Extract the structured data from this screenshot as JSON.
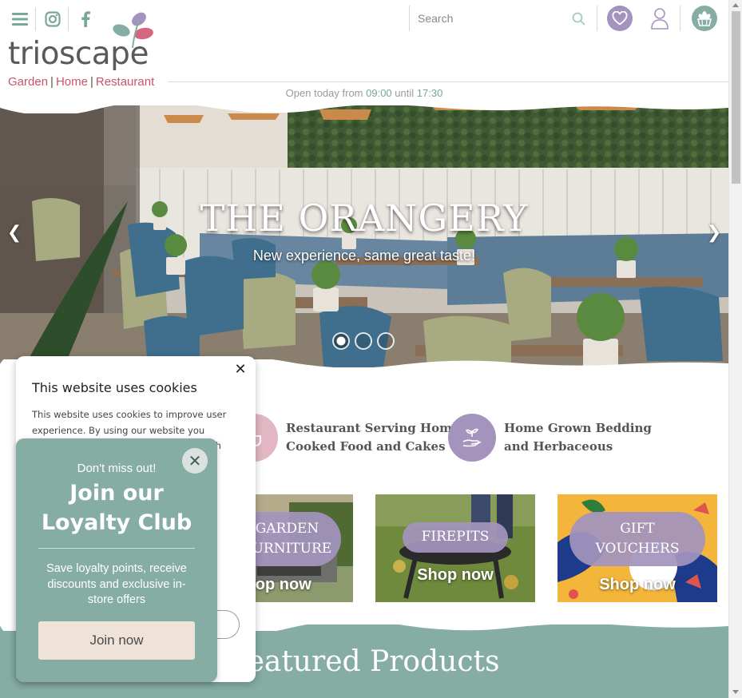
{
  "header": {
    "search_placeholder": "Search",
    "opening_prefix": "Open today from",
    "open_time": "09:00",
    "opening_mid": "until",
    "close_time": "17:30"
  },
  "logo": {
    "name": "trioscape",
    "sub1": "Garden",
    "sub2": "Home",
    "sub3": "Restaurant"
  },
  "hero": {
    "title": "THE ORANGERY",
    "subtitle": "New experience, same great taste!",
    "slides": 3,
    "active_slide": 1
  },
  "features": [
    {
      "line1": "Restaurant Serving Home-",
      "line2": "Cooked Food and Cakes"
    },
    {
      "line1": "Home Grown Bedding",
      "line2": "and Herbaceous"
    }
  ],
  "tiles": [
    {
      "line1": "GARDEN",
      "line2": "FURNITURE",
      "shop": "Shop now"
    },
    {
      "line1": "FIREPITS",
      "line2": "",
      "shop": "Shop now"
    },
    {
      "line1": "GIFT",
      "line2": "VOUCHERS",
      "shop": "Shop now"
    }
  ],
  "featured_title": "Featured Products",
  "cookie": {
    "title": "This website uses cookies",
    "text": "This website uses cookies to improve user experience. By using our website you consent to all cookies in accordance with"
  },
  "loyalty": {
    "small": "Don't miss out!",
    "big_line1": "Join our",
    "big_line2": "Loyalty Club",
    "desc": "Save loyalty points, receive discounts and exclusive in-store offers",
    "button": "Join now"
  },
  "colors": {
    "sage": "#86ada3",
    "lavender": "#a393bd",
    "pink": "#c9546b",
    "cream": "#efe3d9"
  }
}
